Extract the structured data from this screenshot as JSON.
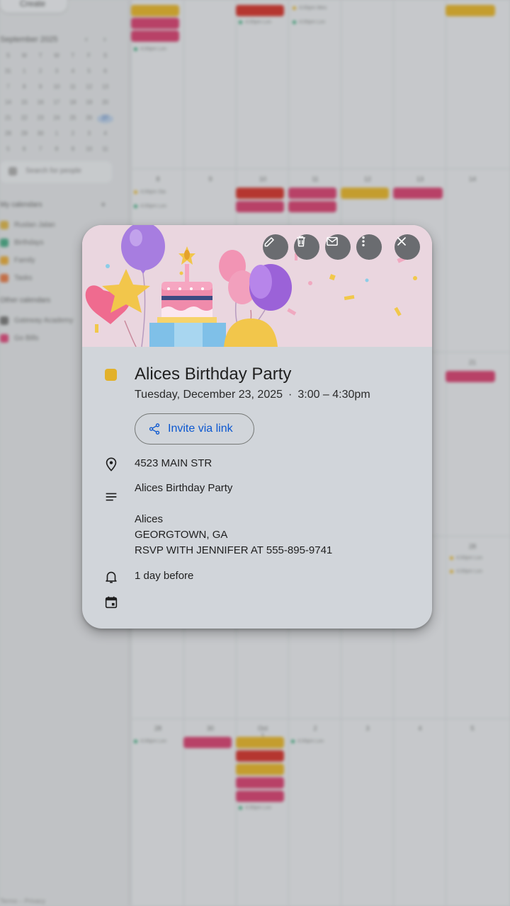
{
  "event": {
    "title": "Alices Birthday Party",
    "date": "Tuesday, December 23, 2025",
    "separator": "·",
    "time": "3:00 – 4:30pm",
    "color": "#e2b12a",
    "invite_label": "Invite via link",
    "location": "4523 MAIN STR",
    "description_line1": "Alices Birthday Party",
    "description_line2": "Alices",
    "description_line3": "GEORGTOWN, GA",
    "description_line4": "RSVP WITH JENNIFER AT 555-895-9741",
    "reminder": "1 day before"
  },
  "actions": [
    {
      "name": "edit",
      "icon": "pencil-icon"
    },
    {
      "name": "delete",
      "icon": "trash-icon"
    },
    {
      "name": "email",
      "icon": "mail-icon"
    },
    {
      "name": "more",
      "icon": "more-vert-icon"
    },
    {
      "name": "close",
      "icon": "close-icon"
    }
  ],
  "row_icons": [
    "location-pin-icon",
    "notes-icon",
    "bell-icon",
    "calendar-icon"
  ],
  "background": {
    "create_label": "Create",
    "month_title": "September 2025",
    "search_people": "Search for people",
    "my_calendars_heading": "My calendars",
    "other_calendars_heading": "Other calendars",
    "calendars": [
      "Ruslan Jalan",
      "Birthdays",
      "Family",
      "Tasks"
    ],
    "other_calendars": [
      "Gateway Academy",
      "Go Bills"
    ],
    "footer": "Terms – Privacy"
  }
}
